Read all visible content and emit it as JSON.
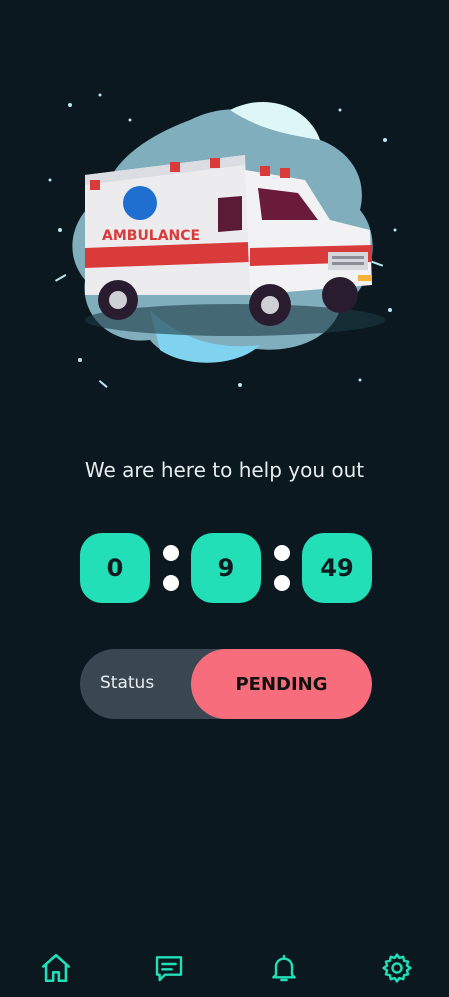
{
  "hero": {
    "illustration": "ambulance-illustration",
    "vehicle_text": "AMBULANCE"
  },
  "tagline": "We are here to help you out",
  "timer": {
    "hours": "0",
    "minutes": "9",
    "seconds": "49"
  },
  "status": {
    "label": "Status",
    "value": "PENDING"
  },
  "bottom_nav": {
    "items": [
      {
        "icon": "home-icon"
      },
      {
        "icon": "chat-icon"
      },
      {
        "icon": "bell-icon"
      },
      {
        "icon": "gear-icon"
      }
    ]
  },
  "colors": {
    "background": "#0b1820",
    "accent": "#22dfb8",
    "status_pending": "#f76d7b",
    "status_track": "#3a4650"
  }
}
